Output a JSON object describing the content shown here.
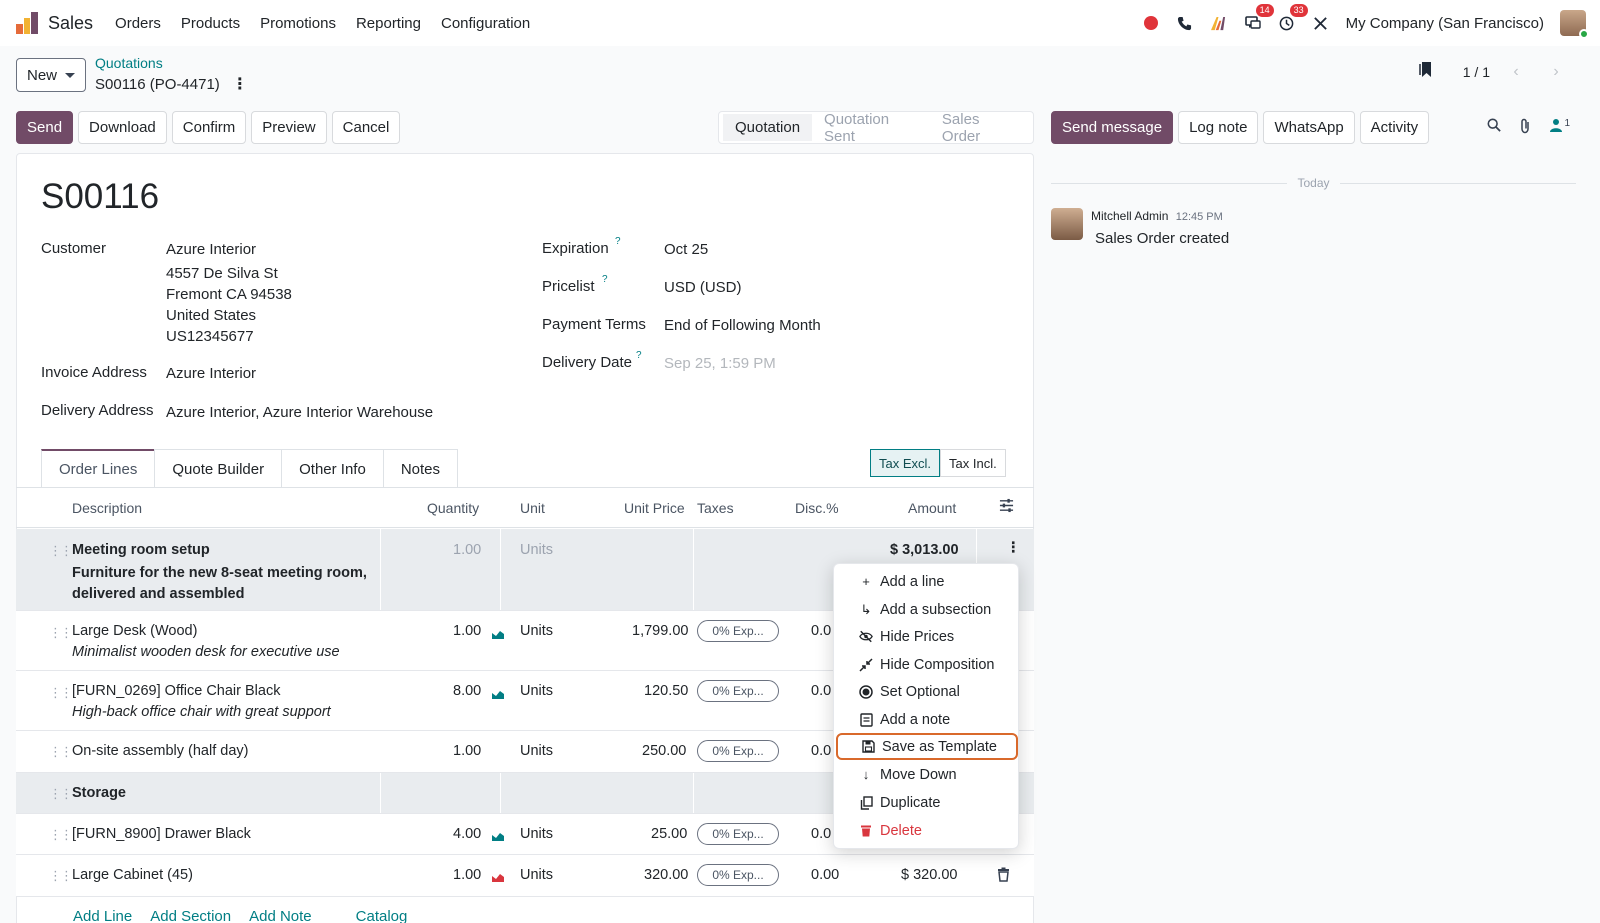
{
  "nav": {
    "app_name": "Sales",
    "menu": [
      "Orders",
      "Products",
      "Promotions",
      "Reporting",
      "Configuration"
    ],
    "badge_messages": "14",
    "badge_activities": "33",
    "company": "My Company (San Francisco)"
  },
  "control": {
    "new_label": "New",
    "breadcrumb_parent": "Quotations",
    "breadcrumb_current": "S00116 (PO-4471)",
    "pager": "1 / 1"
  },
  "actions": [
    "Send",
    "Download",
    "Confirm",
    "Preview",
    "Cancel"
  ],
  "status_stages": [
    "Quotation",
    "Quotation Sent",
    "Sales Order"
  ],
  "chatter": {
    "buttons": [
      "Send message",
      "Log note",
      "WhatsApp",
      "Activity"
    ],
    "followers_count": "1",
    "today": "Today",
    "author": "Mitchell Admin",
    "time": "12:45 PM",
    "message": "Sales Order created"
  },
  "form": {
    "title": "S00116",
    "customer_label": "Customer",
    "customer_lines": [
      "Azure Interior",
      "4557 De Silva St",
      "Fremont CA 94538",
      "United States",
      "US12345677"
    ],
    "invoice_label": "Invoice Address",
    "invoice_value": "Azure Interior",
    "delivery_label": "Delivery Address",
    "delivery_value": "Azure Interior, Azure Interior Warehouse",
    "expiration_label": "Expiration",
    "expiration_value": "Oct 25",
    "pricelist_label": "Pricelist",
    "pricelist_value": "USD (USD)",
    "terms_label": "Payment Terms",
    "terms_value": "End of Following Month",
    "delivery_date_label": "Delivery Date",
    "delivery_date_value": "Sep 25, 1:59 PM",
    "help_mark": "?"
  },
  "tabs": [
    "Order Lines",
    "Quote Builder",
    "Other Info",
    "Notes"
  ],
  "tax_toggle": [
    "Tax Excl.",
    "Tax Incl."
  ],
  "table": {
    "headers": [
      "Description",
      "Quantity",
      "Unit",
      "Unit Price",
      "Taxes",
      "Disc.%",
      "Amount"
    ],
    "rows": [
      {
        "name": "Meeting room setup",
        "note": "Furniture for the new 8-seat meeting room, delivered and assembled",
        "qty": "1.00",
        "unit": "Units",
        "amount": "$ 3,013.00"
      },
      {
        "name": "Large Desk (Wood)",
        "note": "Minimalist wooden desk for executive use",
        "qty": "1.00",
        "unit": "Units",
        "price": "1,799.00",
        "tax": "0% Exp...",
        "disc": "0.0"
      },
      {
        "name": "[FURN_0269] Office Chair Black",
        "note": "High-back office chair with great support",
        "qty": "8.00",
        "unit": "Units",
        "price": "120.50",
        "tax": "0% Exp...",
        "disc": "0.0"
      },
      {
        "name": "On-site assembly (half day)",
        "qty": "1.00",
        "unit": "Units",
        "price": "250.00",
        "tax": "0% Exp...",
        "disc": "0.0"
      },
      {
        "name": "Storage"
      },
      {
        "name": "[FURN_8900] Drawer Black",
        "qty": "4.00",
        "unit": "Units",
        "price": "25.00",
        "tax": "0% Exp...",
        "disc": "0.0"
      },
      {
        "name": "Large Cabinet (45)",
        "qty": "1.00",
        "unit": "Units",
        "price": "320.00",
        "tax": "0% Exp...",
        "disc": "0.00",
        "amount": "$ 320.00"
      }
    ],
    "add_links": [
      "Add Line",
      "Add Section",
      "Add Note",
      "Catalog"
    ]
  },
  "menu_dropdown": [
    "Add a line",
    "Add a subsection",
    "Hide Prices",
    "Hide Composition",
    "Set Optional",
    "Add a note",
    "Save as Template",
    "Move Down",
    "Duplicate",
    "Delete"
  ],
  "colors": {
    "brand": "#714b67",
    "link": "#017e84",
    "danger": "#d9363e",
    "highlight": "#d9692b"
  }
}
